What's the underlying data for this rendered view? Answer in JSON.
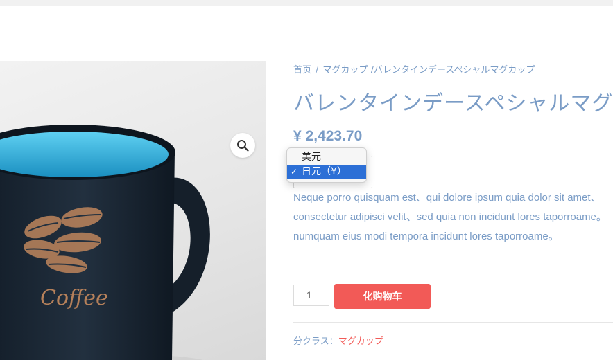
{
  "breadcrumb": {
    "home": "首页",
    "sep": "/",
    "category": "マグカップ",
    "current": "/バレンタインデースペシャルマグカップ"
  },
  "product": {
    "title": "バレンタインデースペシャルマグ",
    "price": "¥ 2,423.70",
    "description": "Neque porro quisquam est、qui dolore ipsum quia dolor sit amet、consectetur adipisci velit、sed quia non incidunt lores taporroame。numquam eius modi tempora incidunt lores taporroame。",
    "image_text": "Coffee"
  },
  "currency": {
    "options": [
      "美元",
      "日元（¥）"
    ],
    "selected": "日元（¥）",
    "check": "✓",
    "chevron": "⌄"
  },
  "cart": {
    "quantity": "1",
    "add_label": "化购物车"
  },
  "meta": {
    "category_label": "分クラス：",
    "category_value": "マグカップ"
  },
  "icons": {
    "zoom": "magnifier-icon"
  },
  "colors": {
    "text": "#7a9cc6",
    "accent": "#f25a57",
    "dropdown_selected": "#2c6fd6",
    "mug_body": "#1c2a38",
    "mug_inner": "#29a9d9"
  }
}
